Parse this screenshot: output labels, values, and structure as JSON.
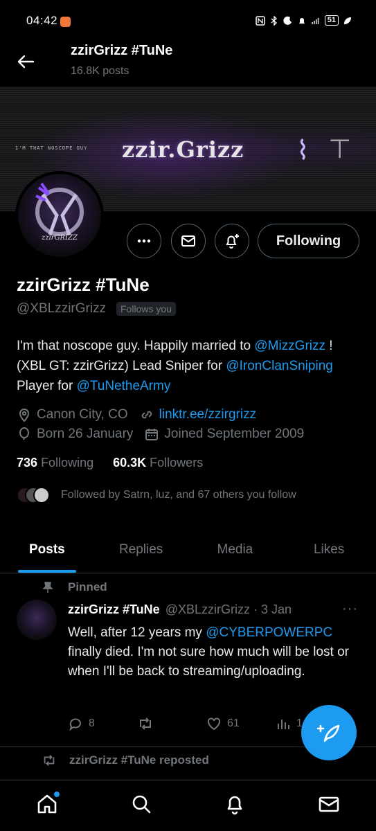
{
  "status_bar": {
    "time": "04:42",
    "battery": "51"
  },
  "header": {
    "title": "zzirGrizz #TuNe",
    "post_count": "16.8K posts"
  },
  "banner": {
    "tagline": "I'M THAT NOSCOPE GUY",
    "name_art": "zzir.Grizz"
  },
  "avatar": {
    "caption": "zzirGRIZZ"
  },
  "actions": {
    "following_label": "Following"
  },
  "profile": {
    "display_name": "zzirGrizz #TuNe",
    "handle": "@XBLzzirGrizz",
    "follows_you": "Follows you",
    "bio_1": "I'm that noscope guy. Happily married to ",
    "bio_link_1": "@MizzGrizz",
    "bio_2": " ! (XBL GT: zzirGrizz) Lead Sniper for ",
    "bio_link_2": "@IronClanSniping",
    "bio_3": " Player for ",
    "bio_link_3": "@TuNetheArmy",
    "location": "Canon City, CO",
    "website": "linktr.ee/zzirgrizz",
    "born": "Born 26 January",
    "joined": "Joined September 2009",
    "following_count": "736",
    "following_label": "Following",
    "followers_count": "60.3K",
    "followers_label": "Followers",
    "followed_by": "Followed by Satrn, luz, and 67 others you follow"
  },
  "tabs": [
    {
      "label": "Posts"
    },
    {
      "label": "Replies"
    },
    {
      "label": "Media"
    },
    {
      "label": "Likes"
    }
  ],
  "pinned_tweet": {
    "pinned_label": "Pinned",
    "name": "zzirGrizz #TuNe",
    "handle_date": "@XBLzzirGrizz · 3 Jan",
    "text_1": "Well, after 12 years my ",
    "text_link": "@CYBERPOWERPC",
    "text_2": " finally died. I'm not sure how much will be lost or when I'll be back to streaming/uploading.",
    "replies": "8",
    "likes": "61",
    "views": "1"
  },
  "repost": {
    "label": "zzirGrizz #TuNe reposted"
  },
  "colors": {
    "accent": "#1d9bf0",
    "muted": "#71767b",
    "background": "#000000"
  }
}
